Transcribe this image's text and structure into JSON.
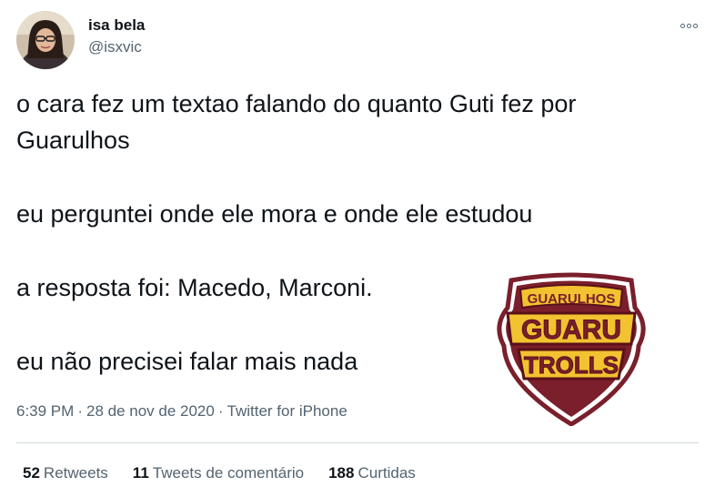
{
  "user": {
    "display_name": "isa bela",
    "handle": "@isxvic"
  },
  "menu": {
    "icon": "more-horizontal-icon"
  },
  "tweet": {
    "lines": [
      "o cara fez um textao falando do quanto Guti fez por",
      "Guarulhos",
      "eu perguntei onde ele mora e onde ele estudou",
      "a resposta foi: Macedo, Marconi.",
      "eu não precisei falar mais nada"
    ]
  },
  "logo": {
    "top_text": "GUARULHOS",
    "mid_text": "GUARU",
    "bottom_text": "TROLLS",
    "colors": {
      "maroon": "#7a1f2b",
      "gold": "#f2c230",
      "outline": "#5a1019"
    }
  },
  "meta": {
    "time": "6:39 PM",
    "date": "28 de nov de 2020",
    "source": "Twitter for iPhone",
    "separator": "·"
  },
  "stats": {
    "retweets_count": "52",
    "retweets_label": "Retweets",
    "quotes_count": "11",
    "quotes_label": "Tweets de comentário",
    "likes_count": "188",
    "likes_label": "Curtidas"
  },
  "colors": {
    "text": "#0f1419",
    "secondary": "#536471",
    "divider": "#cfd9de"
  }
}
